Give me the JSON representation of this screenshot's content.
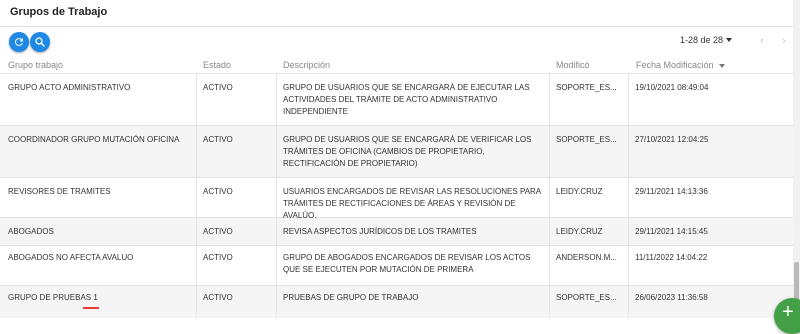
{
  "header": {
    "title": "Grupos de Trabajo"
  },
  "toolbar": {
    "refresh_icon": "refresh-icon",
    "search_icon": "search-icon",
    "range": "1-28 de 28",
    "prev_icon": "chevron-left-icon",
    "next_icon": "chevron-right-icon"
  },
  "table": {
    "columns": {
      "grupo": "Grupo trabajo",
      "estado": "Estado",
      "descripcion": "Descripción",
      "modifico": "Modificó",
      "fecha": "Fecha Modificación"
    },
    "rows": [
      {
        "grupo": "GRUPO ACTO ADMINISTRATIVO",
        "estado": "ACTIVO",
        "descripcion": "GRUPO DE USUARIOS QUE SE ENCARGARÁ DE EJECUTAR LAS ACTIVIDADES DEL TRÁMITE DE ACTO ADMINISTRATIVO INDEPENDIENTE",
        "modifico": "SOPORTE_ES...",
        "fecha": "19/10/2021 08:49:04"
      },
      {
        "grupo": "COORDINADOR GRUPO MUTACIÓN OFICINA",
        "estado": "ACTIVO",
        "descripcion": "GRUPO DE USUARIOS QUE SE ENCARGARÁ DE VERIFICAR LOS TRÁMITES DE OFICINA (CAMBIOS DE PROPIETARIO, RECTIFICACIÓN DE PROPIETARIO)",
        "modifico": "SOPORTE_ES...",
        "fecha": "27/10/2021 12:04:25"
      },
      {
        "grupo": "REVISORES DE TRAMITES",
        "estado": "ACTIVO",
        "descripcion": "USUARIOS ENCARGADOS DE REVISAR LAS RESOLUCIONES PARA TRÁMITES DE RECTIFICACIONES DE ÁREAS Y REVISIÓN DE AVALÚO.",
        "modifico": "LEIDY.CRUZ",
        "fecha": "29/11/2021 14:13:36"
      },
      {
        "grupo": "ABOGADOS",
        "estado": "ACTIVO",
        "descripcion": "REVISA ASPECTOS JURÍDICOS DE LOS TRAMITES",
        "modifico": "LEIDY.CRUZ",
        "fecha": "29/11/2021 14:15:45"
      },
      {
        "grupo": "ABOGADOS NO AFECTA AVALUO",
        "estado": "ACTIVO",
        "descripcion": "GRUPO DE ABOGADOS ENCARGADOS DE REVISAR LOS ACTOS QUE SE EJECUTEN POR MUTACIÓN DE PRIMERA",
        "modifico": "ANDERSON.M...",
        "fecha": "11/11/2022 14:04:22"
      },
      {
        "grupo": "GRUPO DE PRUEBAS 1",
        "estado": "ACTIVO",
        "descripcion": "PRUEBAS DE GRUPO DE TRABAJO",
        "modifico": "SOPORTE_ES...",
        "fecha": "26/06/2023 11:36:58"
      }
    ]
  },
  "fab": {
    "label": "+",
    "icon": "plus-icon"
  },
  "colors": {
    "primary": "#1e88e5",
    "fab": "#43a047",
    "underline": "#e53935",
    "alt_row": "#f5f5f5"
  }
}
